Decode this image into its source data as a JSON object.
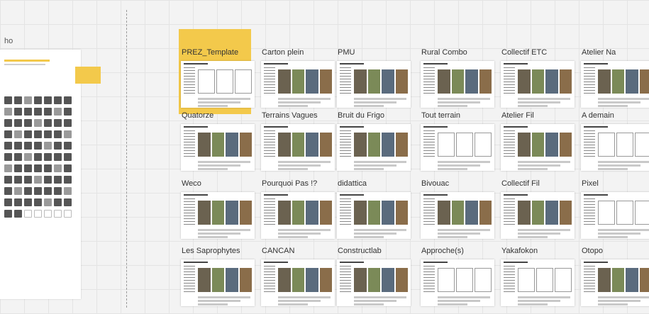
{
  "left_panel": {
    "title": "ho"
  },
  "colors": {
    "accent": "#f3c94b"
  },
  "rows": [
    [
      {
        "name": "PREZ_Template",
        "photos": "empty"
      },
      {
        "name": "Carton plein",
        "photos": "filled"
      },
      {
        "name": "PMU",
        "photos": "filled"
      },
      {
        "name": "Rural Combo",
        "photos": "filled"
      },
      {
        "name": "Collectif ETC",
        "photos": "filled"
      },
      {
        "name": "Atelier Na",
        "photos": "filled"
      }
    ],
    [
      {
        "name": "Quatorze",
        "photos": "filled"
      },
      {
        "name": "Terrains Vagues",
        "photos": "filled"
      },
      {
        "name": "Bruit du Frigo",
        "photos": "filled"
      },
      {
        "name": "Tout terrain",
        "photos": "empty"
      },
      {
        "name": "Atelier Fil",
        "photos": "filled"
      },
      {
        "name": "A demain",
        "photos": "empty"
      }
    ],
    [
      {
        "name": "Weco",
        "photos": "filled"
      },
      {
        "name": "Pourquoi Pas !?",
        "photos": "filled"
      },
      {
        "name": "didattica",
        "photos": "filled"
      },
      {
        "name": "Bivouac",
        "photos": "filled"
      },
      {
        "name": "Collectif Fil",
        "photos": "filled"
      },
      {
        "name": "Pixel",
        "photos": "empty"
      }
    ],
    [
      {
        "name": "Les Saprophytes",
        "photos": "filled"
      },
      {
        "name": "CANCAN",
        "photos": "filled"
      },
      {
        "name": "Constructlab",
        "photos": "filled"
      },
      {
        "name": "Approche(s)",
        "photos": "empty"
      },
      {
        "name": "Yakafokon",
        "photos": "empty"
      },
      {
        "name": "Otopo",
        "photos": "filled"
      }
    ]
  ]
}
